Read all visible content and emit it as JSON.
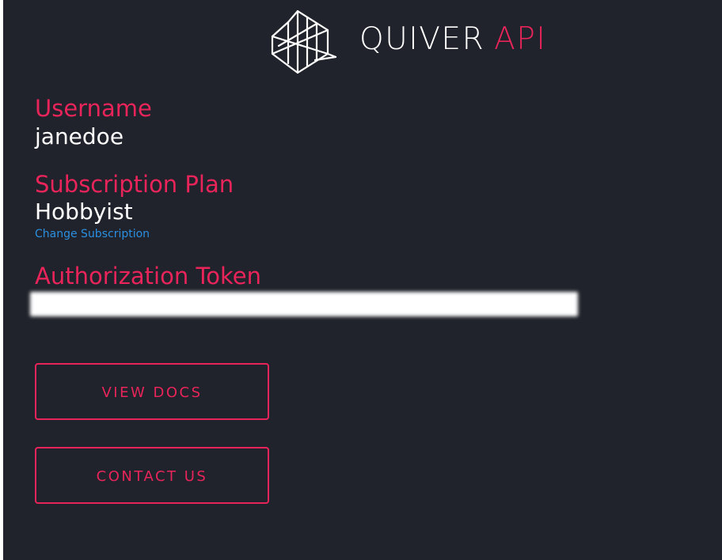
{
  "header": {
    "brand_primary": "QUIVER",
    "brand_accent": "API",
    "logo_icon": "quiver-logo-icon"
  },
  "account": {
    "username_label": "Username",
    "username_value": "janedoe",
    "plan_label": "Subscription Plan",
    "plan_value": "Hobbyist",
    "change_link": "Change Subscription",
    "token_label": "Authorization Token",
    "token_value": ""
  },
  "actions": {
    "docs_label": "VIEW DOCS",
    "contact_label": "CONTACT US"
  },
  "colors": {
    "background": "#20232b",
    "accent": "#e8245a",
    "link": "#2b8fe0",
    "text": "#ffffff"
  }
}
